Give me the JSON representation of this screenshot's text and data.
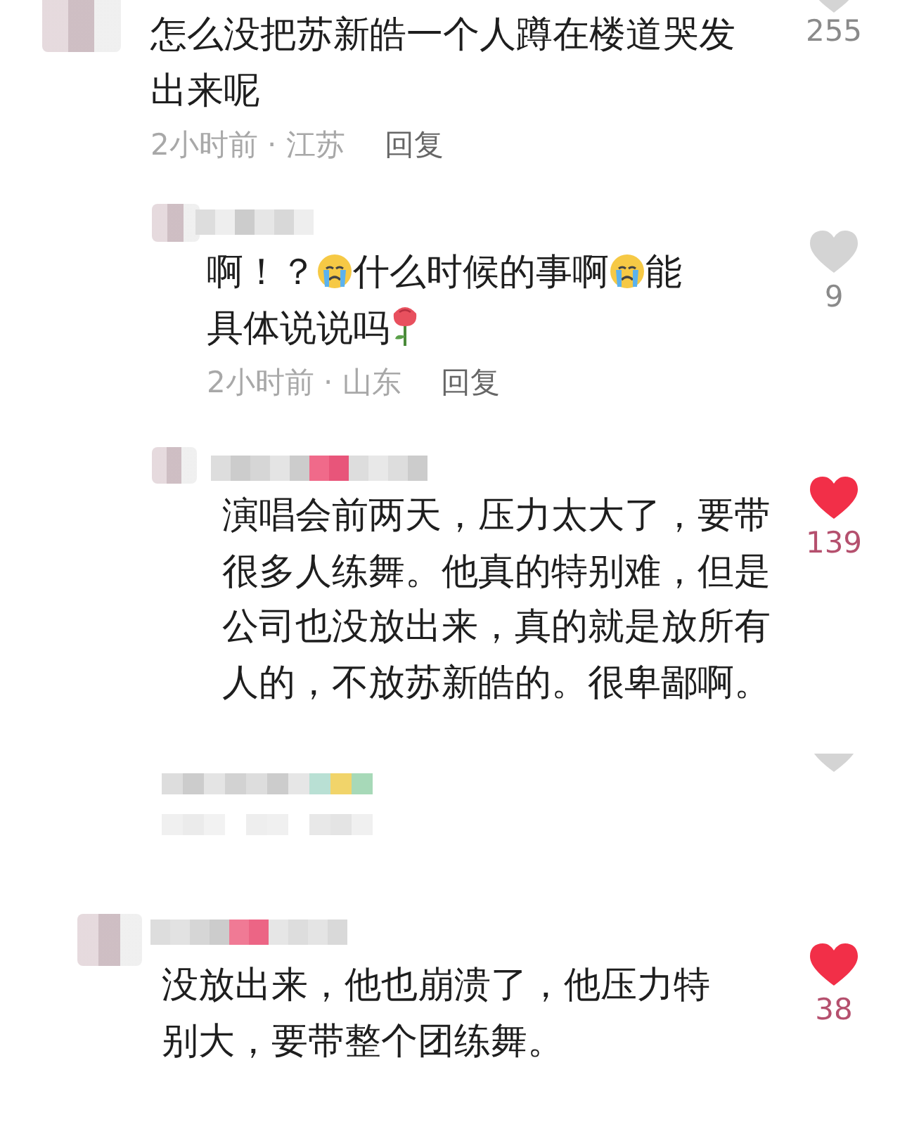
{
  "comments": [
    {
      "kind": "comment",
      "liked": false,
      "likes": "255",
      "parts": [
        {
          "kind": "text",
          "text": "怎么没把苏新皓一个人蹲在楼道哭发出来呢"
        }
      ],
      "meta": "2小时前 · 江苏",
      "reply": "回复"
    },
    {
      "kind": "comment",
      "liked": false,
      "likes": "9",
      "parts": [
        {
          "kind": "text",
          "text": "啊！？"
        },
        {
          "kind": "crying"
        },
        {
          "kind": "text",
          "text": "什么时候的事啊"
        },
        {
          "kind": "crying"
        },
        {
          "kind": "text",
          "text": "能具体说说吗"
        },
        {
          "kind": "rose"
        }
      ],
      "meta": "2小时前 · 山东",
      "reply": "回复"
    },
    {
      "kind": "comment",
      "liked": true,
      "likes": "139",
      "parts": [
        {
          "kind": "text",
          "text": "演唱会前两天，压力太大了，要带很多人练舞。他真的特别难，但是公司也没放出来，真的就是放所有人的，不放苏新皓的。很卑鄙啊。"
        }
      ]
    },
    {
      "kind": "blurred",
      "liked": false
    },
    {
      "kind": "comment",
      "liked": true,
      "likes": "38",
      "parts": [
        {
          "kind": "text",
          "text": "没放出来，他也崩溃了，他压力特别大，要带整个团练舞。"
        }
      ]
    }
  ]
}
